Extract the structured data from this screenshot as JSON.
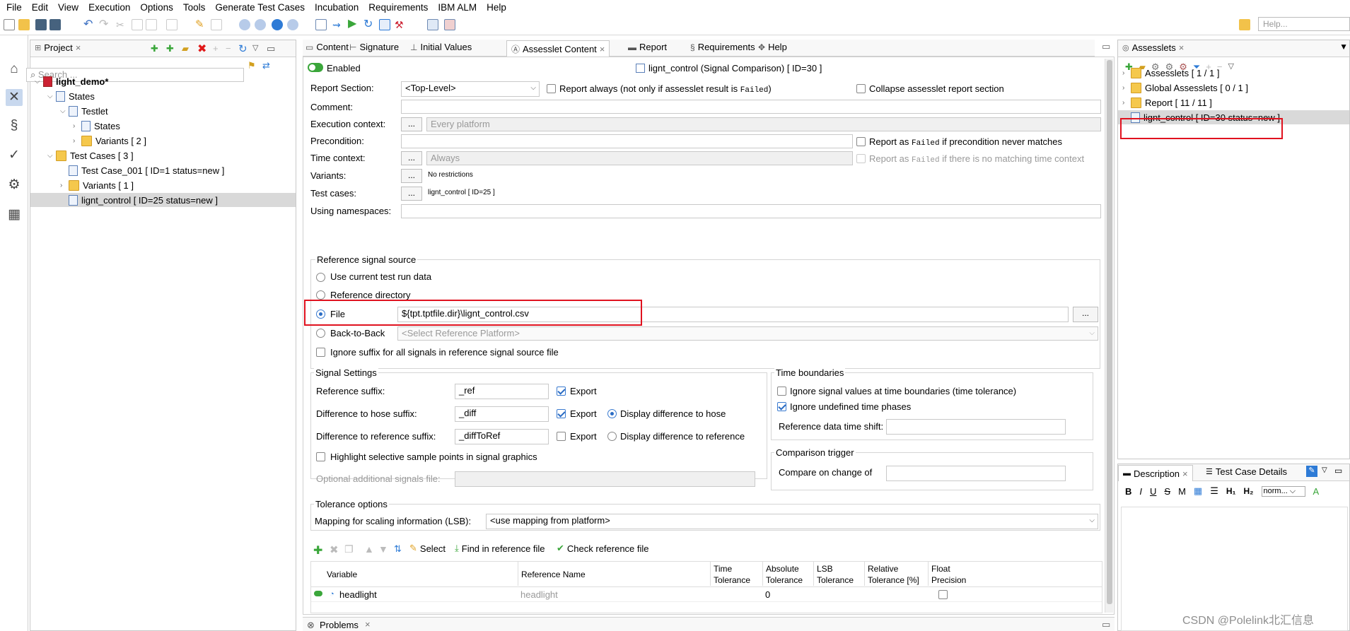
{
  "menu": [
    "File",
    "Edit",
    "View",
    "Execution",
    "Options",
    "Tools",
    "Generate Test Cases",
    "Incubation",
    "Requirements",
    "IBM ALM",
    "Help"
  ],
  "help_placeholder": "Help...",
  "project": {
    "tab": "Project",
    "search_placeholder": "Search ...",
    "tree": [
      {
        "label": "light_demo*",
        "indent": 0,
        "icon": "project",
        "bold": true
      },
      {
        "label": "States",
        "indent": 1,
        "icon": "states"
      },
      {
        "label": "Testlet",
        "indent": 2,
        "icon": "testlet"
      },
      {
        "label": "States",
        "indent": 3,
        "icon": "states"
      },
      {
        "label": "Variants  [ 2 ]",
        "indent": 3,
        "icon": "folder"
      },
      {
        "label": "Test Cases  [ 3 ]",
        "indent": 1,
        "icon": "folder"
      },
      {
        "label": "Test Case_001  [ ID=1 status=new ]",
        "indent": 2,
        "icon": "testcase"
      },
      {
        "label": "Variants  [ 1 ]",
        "indent": 2,
        "icon": "folder"
      },
      {
        "label": "lignt_control  [ ID=25 status=new ]",
        "indent": 2,
        "icon": "testcase",
        "selected": true
      }
    ]
  },
  "editor_tabs": [
    "Content",
    "Signature",
    "Initial Values",
    "Assesslet Content",
    "Report",
    "Requirements",
    "Help"
  ],
  "header": {
    "enabled": "Enabled",
    "title": "lignt_control (Signal Comparison) [ ID=30 ]"
  },
  "form": {
    "report_section_label": "Report Section:",
    "report_section_value": "<Top-Level>",
    "report_always": "Report always (not only if assesslet result is ",
    "failed": "Failed",
    "collapse": "Collapse assesslet report section",
    "comment_label": "Comment:",
    "exec_label": "Execution context:",
    "exec_value": "Every platform",
    "precond_label": "Precondition:",
    "report_failed_pre": "Report as ",
    "report_failed_pc": " if precondition never matches",
    "time_label": "Time context:",
    "time_value": "Always",
    "report_failed_tc": " if there is no matching time context",
    "variants_label": "Variants:",
    "variants_value": "No restrictions",
    "testcases_label": "Test cases:",
    "testcases_value": "lignt_control [ ID=25 ]",
    "ns_label": "Using namespaces:",
    "dots": "..."
  },
  "ref_source": {
    "title": "Reference signal source",
    "opt1": "Use current test run data",
    "opt2": "Reference directory",
    "opt3": "File",
    "file_value": "${tpt.tptfile.dir}\\lignt_control.csv",
    "opt4": "Back-to-Back",
    "b2b_placeholder": "<Select Reference Platform>",
    "ignore_suffix": "Ignore suffix for all signals in reference signal source file"
  },
  "signal_settings": {
    "title": "Signal Settings",
    "ref_suffix_label": "Reference suffix:",
    "ref_suffix": "_ref",
    "diff_hose_label": "Difference to hose suffix:",
    "diff_hose": "_diff",
    "diff_ref_label": "Difference to reference suffix:",
    "diff_ref": "_diffToRef",
    "export": "Export",
    "display_hose": "Display difference to hose",
    "display_ref": "Display difference to reference",
    "highlight": "Highlight selective sample points in signal graphics",
    "optional_label": "Optional additional signals file:"
  },
  "time_boundaries": {
    "title": "Time boundaries",
    "ignore_values": "Ignore signal values at time boundaries (time tolerance)",
    "ignore_undefined": "Ignore undefined time phases",
    "shift_label": "Reference data time shift:"
  },
  "comparison_trigger": {
    "title": "Comparison trigger",
    "label": "Compare on change of"
  },
  "tolerance": {
    "title": "Tolerance options",
    "mapping_label": "Mapping for scaling information (LSB):",
    "mapping_value": "<use mapping from platform>"
  },
  "table_toolbar": {
    "select": "Select",
    "find": "Find in reference file",
    "check": "Check reference file"
  },
  "table": {
    "headers": [
      "Variable",
      "Reference Name",
      "Time\nTolerance",
      "Absolute\nTolerance",
      "LSB\nTolerance",
      "Relative\nTolerance [%]",
      "Float\nPrecision"
    ],
    "rows": [
      {
        "variable": "headlight",
        "reference": "headlight",
        "time": "",
        "absolute": "0",
        "lsb": "",
        "relative": ""
      }
    ]
  },
  "bottom_tab": "Problems",
  "assesslets": {
    "tab": "Assesslets",
    "tree": [
      {
        "label": "Assesslets  [ 1 / 1 ]"
      },
      {
        "label": "Global Assesslets  [ 0 / 1 ]"
      },
      {
        "label": "Report  [ 11 / 11 ]"
      },
      {
        "label": "lignt_control  [ ID=30 status=new ]",
        "selected": true
      }
    ]
  },
  "description": {
    "tab1": "Description",
    "tab2": "Test Case Details",
    "font": "norm..."
  },
  "watermark": "CSDN @Polelink北汇信息",
  "colors": {
    "highlight_red": "#e0121f",
    "accent_blue": "#2a6cc4",
    "add_green": "#3aa63a"
  }
}
